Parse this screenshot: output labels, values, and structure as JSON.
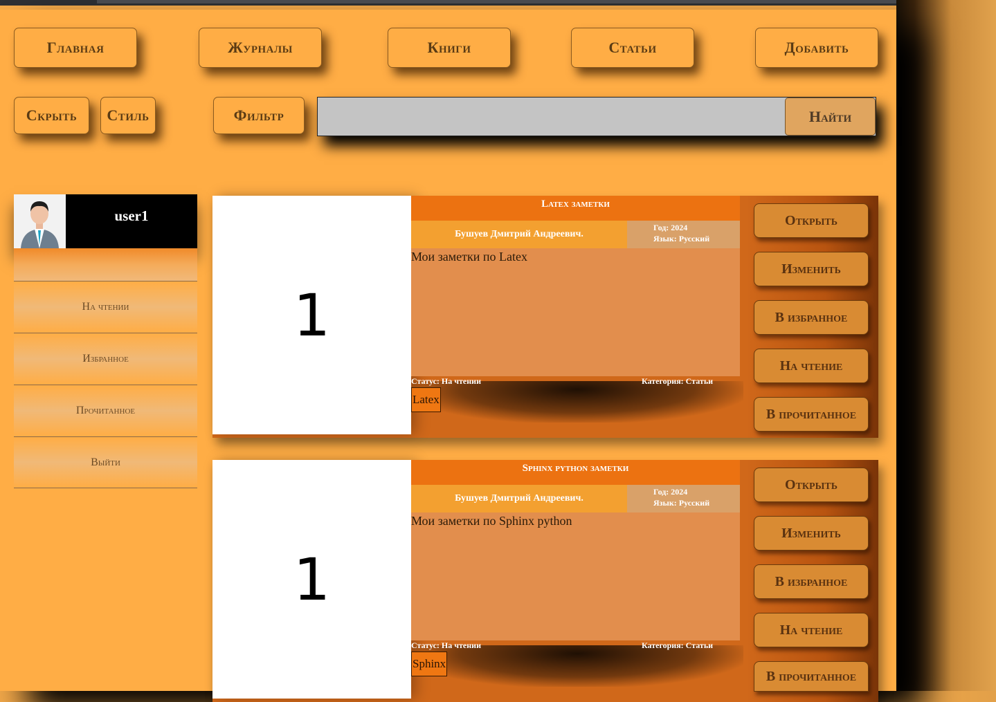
{
  "nav": {
    "home": "Главная",
    "journals": "Журналы",
    "books": "Книги",
    "articles": "Статьи",
    "add": "Добавить"
  },
  "toolbar": {
    "hide": "Скрыть",
    "style": "Стиль",
    "filter": "Фильтр",
    "search_value": "",
    "find": "Найти"
  },
  "profile": {
    "username": "user1"
  },
  "sidebar": {
    "items": [
      {
        "label": "На чтении"
      },
      {
        "label": "Избранное"
      },
      {
        "label": "Прочитанное"
      },
      {
        "label": "Выйти"
      }
    ]
  },
  "cards": [
    {
      "thumb_text": "1",
      "title": "Latex заметки",
      "author": "Бушуев Дмитрий Андреевич.",
      "year": "Год: 2024",
      "language": "Язык: Русский",
      "description": "Мои заметки по Latex",
      "status": "Статус: На чтении",
      "category": "Категория: Статьи",
      "tag": "Latex"
    },
    {
      "thumb_text": "1",
      "title": "Sphinx python заметки",
      "author": "Бушуев Дмитрий Андреевич.",
      "year": "Год: 2024",
      "language": "Язык: Русский",
      "description": "Мои заметки по Sphinx python",
      "status": "Статус: На чтении",
      "category": "Категория: Статьи",
      "tag": "Sphinx"
    }
  ],
  "card_actions": {
    "open": "Открыть",
    "edit": "Изменить",
    "favorite": "В избранное",
    "reading": "На чтение",
    "read": "В прочитанное"
  },
  "colors": {
    "background": "#ffad45",
    "card_title": "#ec7211",
    "card_author": "#f3a030",
    "card_meta": "#d9a169",
    "card_desc": "#e28e4d",
    "tag": "#ef7712",
    "profile_bg": "#000000"
  }
}
